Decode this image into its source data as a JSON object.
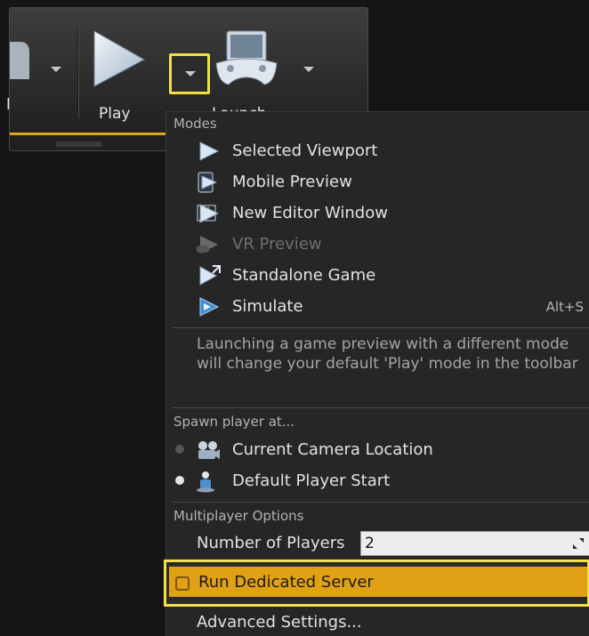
{
  "toolbar": {
    "prev_button_label_fragment": "l",
    "play_label": "Play",
    "launch_label": "Launch",
    "play_options_icon": "chevron-down-icon"
  },
  "menu": {
    "modes_header": "Modes",
    "modes": [
      {
        "label": "Selected Viewport",
        "icon": "play-icon",
        "checked": false,
        "enabled": true
      },
      {
        "label": "Mobile Preview",
        "icon": "mobile-preview-icon",
        "checked": false,
        "enabled": true
      },
      {
        "label": "New Editor Window",
        "icon": "new-window-play-icon",
        "checked": true,
        "enabled": true
      },
      {
        "label": "VR Preview",
        "icon": "vr-preview-icon",
        "checked": false,
        "enabled": false
      },
      {
        "label": "Standalone Game",
        "icon": "standalone-game-icon",
        "checked": false,
        "enabled": true
      },
      {
        "label": "Simulate",
        "icon": "simulate-icon",
        "checked": false,
        "enabled": true,
        "shortcut": "Alt+S"
      }
    ],
    "check_mark": "✓",
    "note": "Launching a game preview with a different mode will change your default 'Play' mode in the toolbar",
    "spawn_header": "Spawn player at...",
    "spawn_options": [
      {
        "label": "Current Camera Location",
        "icon": "camera-icon",
        "selected": false
      },
      {
        "label": "Default Player Start",
        "icon": "player-start-icon",
        "selected": true
      }
    ],
    "multiplayer_header": "Multiplayer Options",
    "num_players_label": "Number of Players",
    "num_players_value": "2",
    "dedicated_server_label": "Run Dedicated Server",
    "dedicated_server_checked": false,
    "advanced_label": "Advanced Settings..."
  },
  "colors": {
    "highlight": "#e0a114",
    "callout_outline": "#f2e246",
    "menu_bg": "#262626"
  }
}
